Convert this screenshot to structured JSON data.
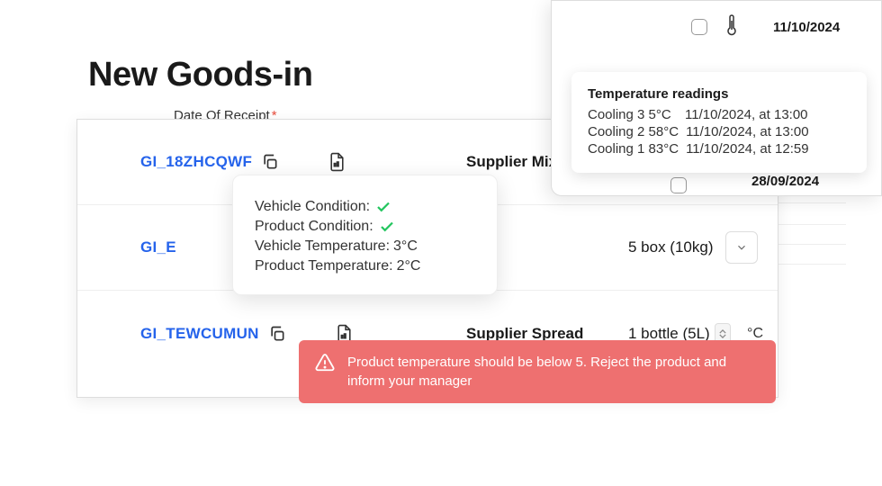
{
  "header": {
    "title": "New Goods-in",
    "date_label": "Date Of Receipt",
    "required_marker": "*"
  },
  "rows": [
    {
      "id": "GI_18ZHCQWF",
      "supplier": "Supplier Mixed"
    },
    {
      "id_partial": "GI_E",
      "quantity": "5 box (10kg)"
    },
    {
      "id": "GI_TEWCUMUN",
      "supplier": "Supplier Spread",
      "quantity": "1 bottle (5L)",
      "unit": "°C"
    }
  ],
  "condition_popup": {
    "vehicle_condition_label": "Vehicle Condition:",
    "product_condition_label": "Product Condition:",
    "vehicle_temp_label": "Vehicle Temperature:",
    "vehicle_temp_value": "3°C",
    "product_temp_label": "Product Temperature:",
    "product_temp_value": "2°C"
  },
  "temperature_panel": {
    "top_date": "11/10/2024",
    "bottom_date": "28/09/2024",
    "readings_heading": "Temperature readings",
    "readings": [
      {
        "label": "Cooling 3 5°C",
        "datetime": "11/10/2024, at 13:00"
      },
      {
        "label": "Cooling 2 58°C",
        "datetime": "11/10/2024, at 13:00"
      },
      {
        "label": "Cooling 1 83°C",
        "datetime": "11/10/2024, at 12:59"
      }
    ]
  },
  "alert": {
    "message": "Product temperature should be below 5. Reject the product and inform your manager"
  },
  "colors": {
    "primary_link": "#2563eb",
    "alert_bg": "#ee7070",
    "check_green": "#22c55e"
  }
}
